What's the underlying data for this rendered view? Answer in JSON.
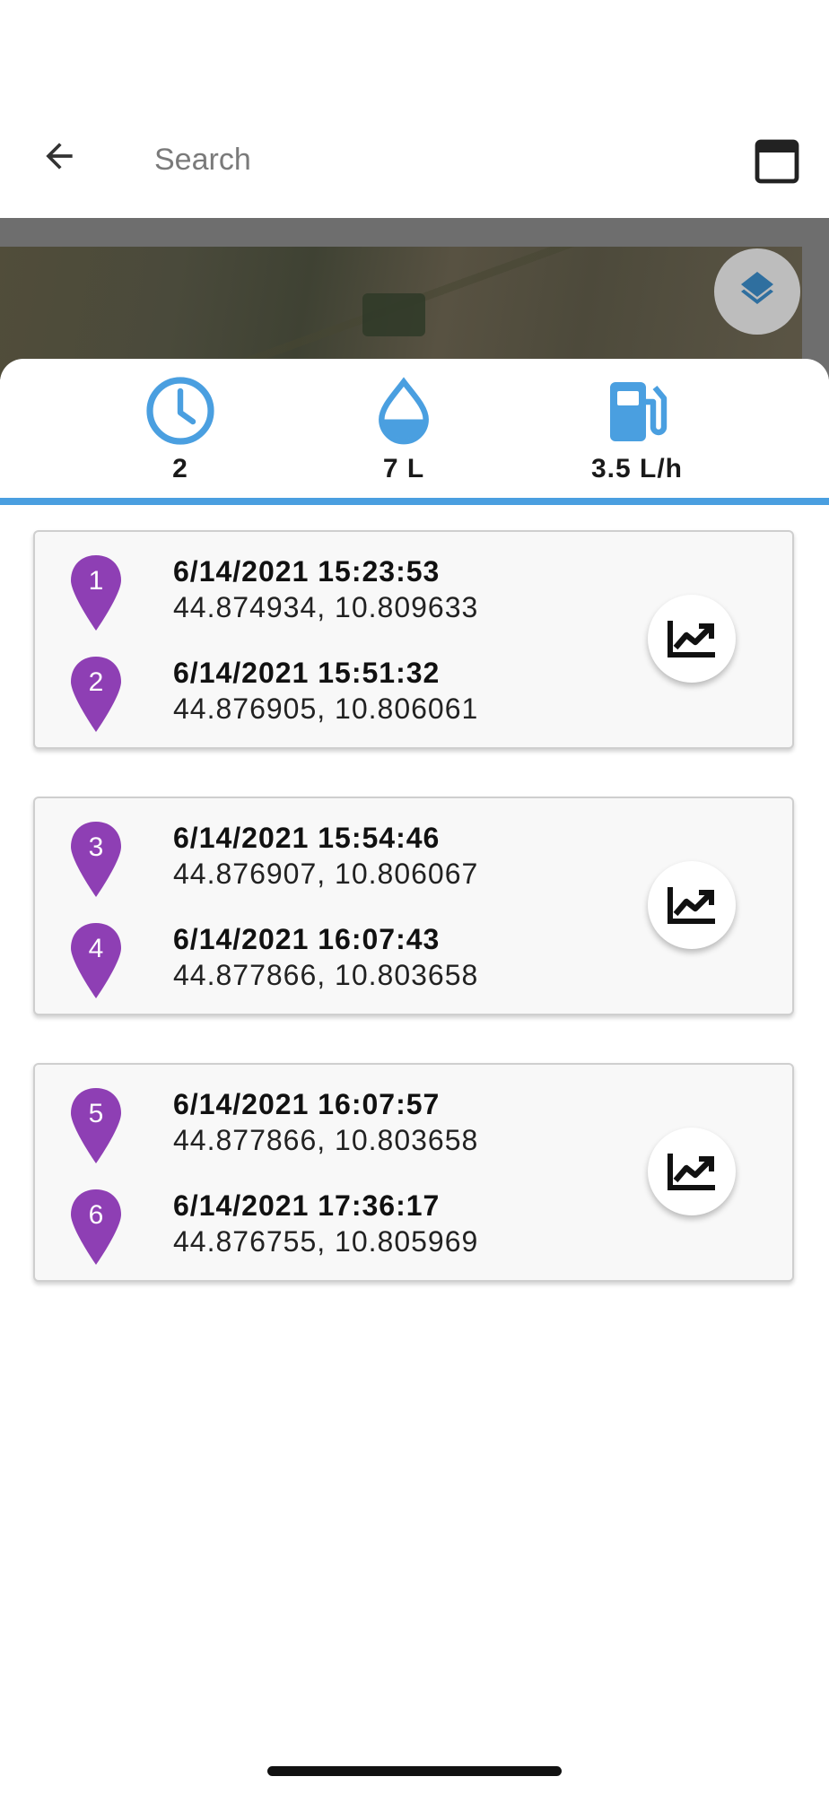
{
  "search": {
    "placeholder": "Search",
    "value": ""
  },
  "icons": {
    "back": "arrow-back-icon",
    "calendar": "calendar-icon",
    "layers": "layers-icon",
    "time": "clock-icon",
    "fuel_volume": "droplet-icon",
    "fuel_rate": "fuel-pump-icon",
    "chart": "trending-up-icon",
    "point": "map-pin-icon"
  },
  "colors": {
    "accent": "#4a9fe0",
    "pin": "#8e3fb4"
  },
  "stats": {
    "time_value": "2",
    "fuel_value": "7 L",
    "rate_value": "3.5 L/h"
  },
  "segments": [
    {
      "start": {
        "num": "1",
        "time": "6/14/2021 15:23:53",
        "coords": "44.874934, 10.809633"
      },
      "end": {
        "num": "2",
        "time": "6/14/2021 15:51:32",
        "coords": "44.876905, 10.806061"
      }
    },
    {
      "start": {
        "num": "3",
        "time": "6/14/2021 15:54:46",
        "coords": "44.876907, 10.806067"
      },
      "end": {
        "num": "4",
        "time": "6/14/2021 16:07:43",
        "coords": "44.877866, 10.803658"
      }
    },
    {
      "start": {
        "num": "5",
        "time": "6/14/2021 16:07:57",
        "coords": "44.877866, 10.803658"
      },
      "end": {
        "num": "6",
        "time": "6/14/2021 17:36:17",
        "coords": "44.876755, 10.805969"
      }
    }
  ]
}
